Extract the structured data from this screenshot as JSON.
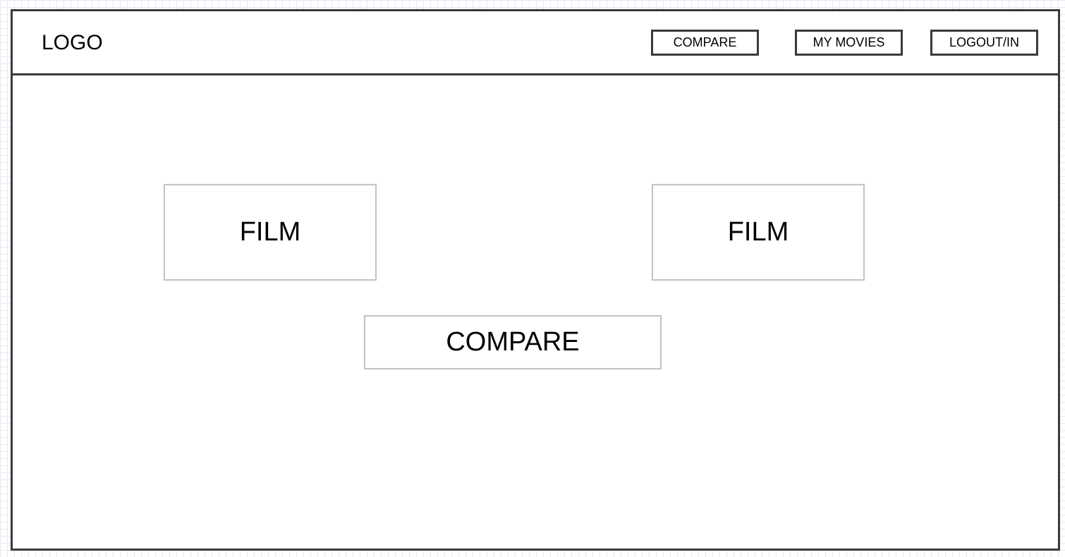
{
  "header": {
    "logo_text": "LOGO",
    "nav": {
      "compare_label": "COMPARE",
      "my_movies_label": "MY MOVIES",
      "logout_label": "LOGOUT/IN"
    }
  },
  "main": {
    "film_left_label": "FILM",
    "film_right_label": "FILM",
    "compare_button_label": "COMPARE"
  }
}
